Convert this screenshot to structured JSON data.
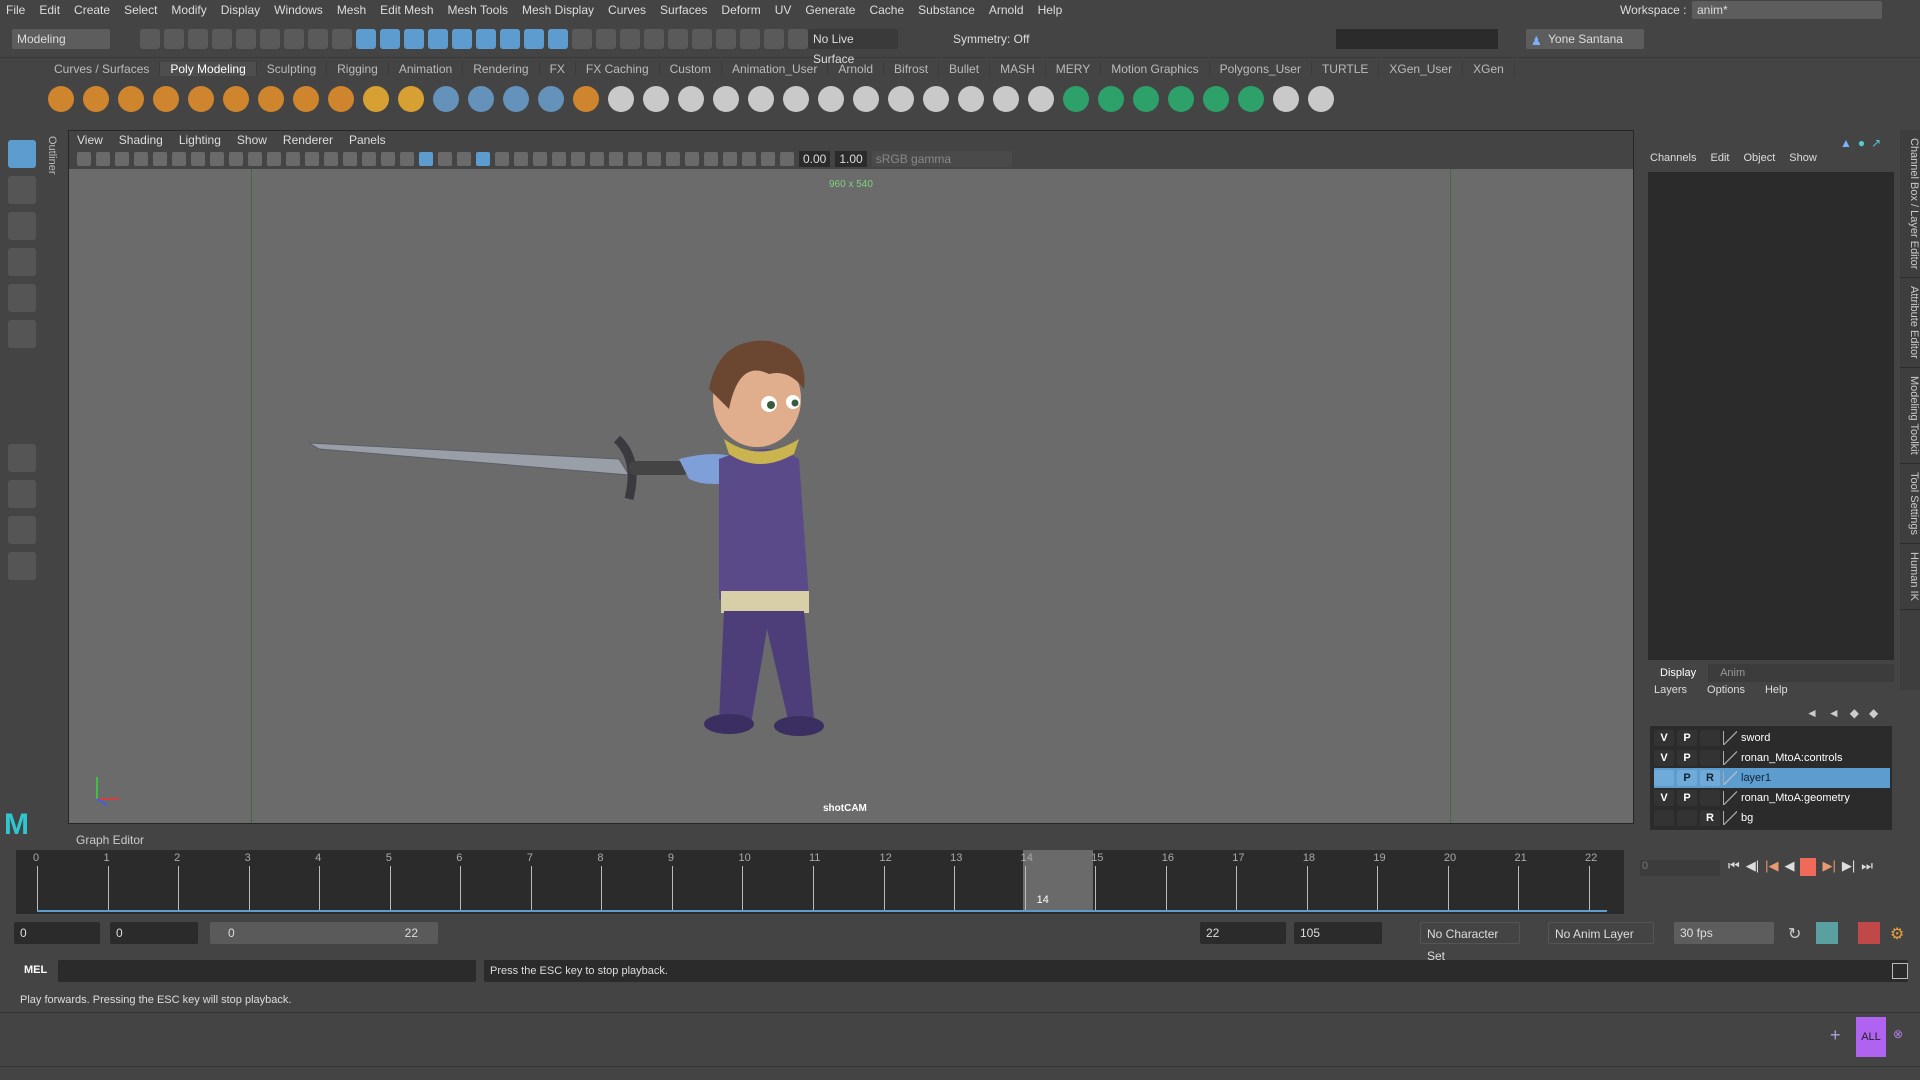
{
  "menu": [
    "File",
    "Edit",
    "Create",
    "Select",
    "Modify",
    "Display",
    "Windows",
    "Mesh",
    "Edit Mesh",
    "Mesh Tools",
    "Mesh Display",
    "Curves",
    "Surfaces",
    "Deform",
    "UV",
    "Generate",
    "Cache",
    "Substance",
    "Arnold",
    "Help"
  ],
  "workspace": {
    "label": "Workspace :",
    "value": "anim*"
  },
  "status": {
    "mode": "Modeling",
    "live_surface": "No Live Surface",
    "symmetry": "Symmetry: Off",
    "user": "Yone Santana"
  },
  "shelf_tabs": [
    "Curves / Surfaces",
    "Poly Modeling",
    "Sculpting",
    "Rigging",
    "Animation",
    "Rendering",
    "FX",
    "FX Caching",
    "Custom",
    "Animation_User",
    "Arnold",
    "Bifrost",
    "Bullet",
    "MASH",
    "MERY",
    "Motion Graphics",
    "Polygons_User",
    "TURTLE",
    "XGen_User",
    "XGen"
  ],
  "shelf_active": "Poly Modeling",
  "shelf_colors": [
    "#e8902a",
    "#e8902a",
    "#e8902a",
    "#e8902a",
    "#e8902a",
    "#e8902a",
    "#e8902a",
    "#e8902a",
    "#e8902a",
    "#f0b030",
    "#f0b030",
    "#6aa0d0",
    "#6aa0d0",
    "#6aa0d0",
    "#6aa0d0",
    "#e8902a",
    "#e0e0e0",
    "#e0e0e0",
    "#e0e0e0",
    "#e0e0e0",
    "#e0e0e0",
    "#e0e0e0",
    "#e0e0e0",
    "#e0e0e0",
    "#e0e0e0",
    "#e0e0e0",
    "#e0e0e0",
    "#e0e0e0",
    "#e0e0e0",
    "#2ab070",
    "#2ab070",
    "#2ab070",
    "#2ab070",
    "#2ab070",
    "#2ab070",
    "#e0e0e0",
    "#e0e0e0"
  ],
  "outliner_label": "Outliner",
  "viewport": {
    "menu": [
      "View",
      "Shading",
      "Lighting",
      "Show",
      "Renderer",
      "Panels"
    ],
    "exposure": "0.00",
    "gamma": "1.00",
    "color_space": "sRGB gamma",
    "resolution": "960 x 540",
    "camera": "shotCAM"
  },
  "channel_box": {
    "menu": [
      "Channels",
      "Edit",
      "Object",
      "Show"
    ]
  },
  "side_tabs": [
    "Channel Box / Layer Editor",
    "Attribute Editor",
    "Modeling Toolkit",
    "Tool Settings",
    "Human IK"
  ],
  "layer_editor": {
    "tabs": [
      "Display",
      "Anim"
    ],
    "menu": [
      "Layers",
      "Options",
      "Help"
    ],
    "layers": [
      {
        "v": "V",
        "p": "P",
        "r": "",
        "name": "sword",
        "selected": false
      },
      {
        "v": "V",
        "p": "P",
        "r": "",
        "name": "ronan_MtoA:controls",
        "selected": false
      },
      {
        "v": "",
        "p": "P",
        "r": "R",
        "name": "layer1",
        "selected": true
      },
      {
        "v": "V",
        "p": "P",
        "r": "",
        "name": "ronan_MtoA:geometry",
        "selected": false
      },
      {
        "v": "",
        "p": "",
        "r": "R",
        "name": "bg",
        "selected": false
      }
    ]
  },
  "graph_editor_label": "Graph Editor",
  "timeline": {
    "start": 0,
    "end": 22,
    "current": 14,
    "current_label": "14",
    "frame_field": "0"
  },
  "range": {
    "start": "0",
    "anim_start": "0",
    "range_start": "0",
    "range_end": "22",
    "end": "22",
    "anim_end": "105",
    "character_set": "No Character Set",
    "anim_layer": "No Anim Layer",
    "fps": "30 fps"
  },
  "command": {
    "lang": "MEL",
    "result": "Press the ESC key to stop playback."
  },
  "help_line": "Play forwards. Pressing the ESC key will stop playback.",
  "bottom": {
    "all_label": "ALL"
  },
  "colors": {
    "accent": "#5d9ccf",
    "play_button": "#f06a5a",
    "all_button": "#b063f0"
  }
}
